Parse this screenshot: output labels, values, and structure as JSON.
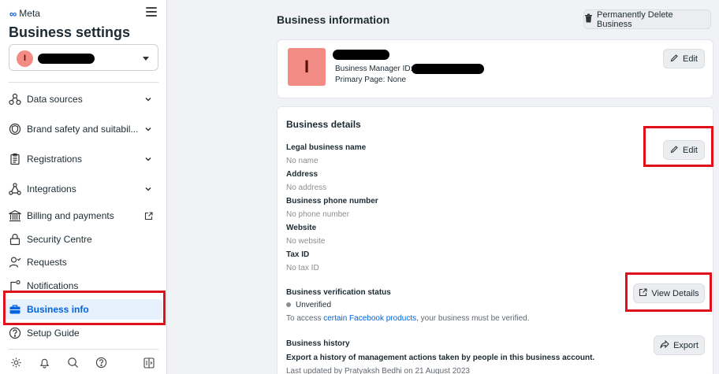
{
  "sidebar": {
    "brand": "Meta",
    "title": "Business settings",
    "account_initial": "I",
    "items": [
      {
        "label": "Data sources"
      },
      {
        "label": "Brand safety and suitabil..."
      },
      {
        "label": "Registrations"
      },
      {
        "label": "Integrations"
      },
      {
        "label": "Billing and payments"
      },
      {
        "label": "Security Centre"
      },
      {
        "label": "Requests"
      },
      {
        "label": "Notifications"
      },
      {
        "label": "Business info"
      },
      {
        "label": "Setup Guide"
      }
    ]
  },
  "main": {
    "title": "Business information",
    "delete_button": "Permanently Delete Business",
    "profile": {
      "initial": "I",
      "manager_id_label": "Business Manager ID:",
      "primary_page": "Primary Page: None",
      "edit_label": "Edit"
    },
    "details": {
      "title": "Business details",
      "edit_label": "Edit",
      "fields": [
        {
          "label": "Legal business name",
          "value": "No name"
        },
        {
          "label": "Address",
          "value": "No address"
        },
        {
          "label": "Business phone number",
          "value": "No phone number"
        },
        {
          "label": "Website",
          "value": "No website"
        },
        {
          "label": "Tax ID",
          "value": "No tax ID"
        }
      ],
      "verification": {
        "label": "Business verification status",
        "status": "Unverified",
        "note_prefix": "To access ",
        "note_link": "certain Facebook products",
        "note_suffix": ", your business must be verified.",
        "view_details": "View Details"
      },
      "history": {
        "label": "Business history",
        "description": "Export a history of management actions taken by people in this business account.",
        "last_updated": "Last updated by Pratyaksh Bedhi on 21 August 2023",
        "export_label": "Export"
      }
    }
  },
  "colors": {
    "accent": "#0064e0",
    "highlight": "#e0101a",
    "avatar": "#f38c84"
  }
}
